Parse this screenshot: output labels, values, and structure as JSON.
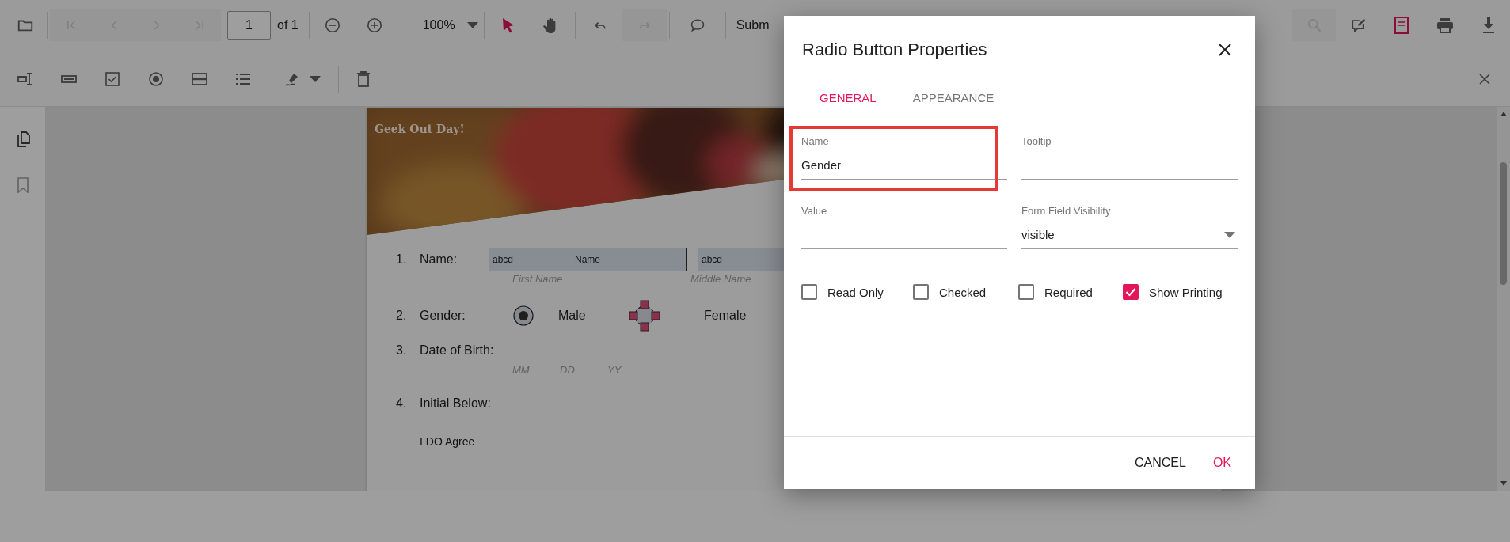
{
  "toolbar": {
    "navigation": [
      {
        "kind": "first",
        "disabled": true
      },
      {
        "kind": "previous",
        "disabled": true
      },
      {
        "kind": "next",
        "disabled": true
      },
      {
        "kind": "last",
        "disabled": true
      }
    ],
    "page_number": "1",
    "page_total": "of 1",
    "zoom": "100%",
    "modes": [
      {
        "kind": "select",
        "selected": true
      },
      {
        "kind": "pan",
        "selected": false
      }
    ],
    "history": [
      {
        "kind": "undo",
        "disabled": false
      },
      {
        "kind": "redo",
        "disabled": true
      }
    ],
    "submit_label": "Subm",
    "right_tools": [
      {
        "kind": "search",
        "selected": false,
        "disabled": true
      },
      {
        "kind": "edit",
        "selected": false,
        "disabled": false
      },
      {
        "kind": "form_fields",
        "selected": true,
        "disabled": false
      },
      {
        "kind": "print",
        "selected": false,
        "disabled": false
      },
      {
        "kind": "download",
        "selected": false,
        "disabled": false
      }
    ]
  },
  "document": {
    "heading": "Geek Out Day!",
    "name_row": {
      "number": "1.",
      "label": "Name:",
      "fields": [
        {
          "value": "abcd",
          "title": "Name",
          "caption": "First Name"
        },
        {
          "value": "abcd",
          "caption": "Middle Name"
        }
      ]
    },
    "gender_row": {
      "number": "2.",
      "label": "Gender:",
      "options": [
        {
          "label": "Male",
          "checked": true,
          "selected": false
        },
        {
          "label": "Female",
          "checked": false,
          "selected": true
        }
      ]
    },
    "birth_row": {
      "number": "3.",
      "label": "Date of Birth:",
      "captions": [
        "MM",
        "DD",
        "YY"
      ]
    },
    "initial_row": {
      "number": "4.",
      "label": "Initial Below:"
    },
    "agreement": "I DO Agree"
  },
  "dialog": {
    "title": "Radio Button Properties",
    "tabs": [
      {
        "label": "GENERAL",
        "selected": true
      },
      {
        "label": "APPEARANCE",
        "selected": false
      }
    ],
    "fields": [
      {
        "label": "Name",
        "value": "Gender",
        "kind": "text",
        "highlighted": true
      },
      {
        "label": "Tooltip",
        "kind": "text",
        "highlighted": false
      },
      {
        "label": "Value",
        "kind": "text",
        "highlighted": false
      },
      {
        "label": "Form Field Visibility",
        "value": "visible",
        "kind": "dropdown",
        "highlighted": false
      }
    ],
    "checkboxes": [
      {
        "label": "Read Only",
        "checked": false
      },
      {
        "label": "Checked",
        "checked": false
      },
      {
        "label": "Required",
        "checked": false
      },
      {
        "label": "Show Printing",
        "checked": true
      }
    ],
    "buttons": [
      {
        "label": "CANCEL",
        "kind": "secondary"
      },
      {
        "label": "OK",
        "kind": "primary"
      }
    ]
  }
}
